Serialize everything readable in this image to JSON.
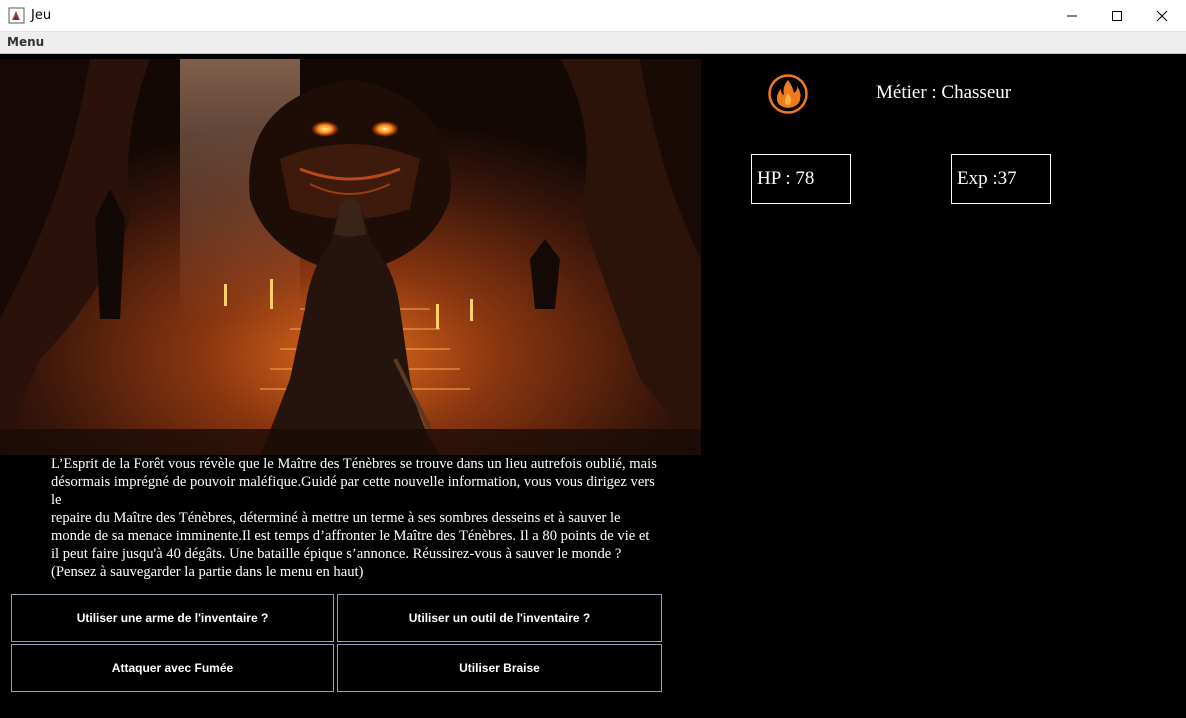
{
  "window": {
    "title": "Jeu",
    "controls": [
      "minimize-icon",
      "maximize-icon",
      "close-icon"
    ]
  },
  "menubar": {
    "menu_label": "Menu"
  },
  "scene": {
    "image_icon": "hooded-hero-facing-demon-in-cave"
  },
  "story": {
    "lines": [
      "L’Esprit de la Forêt vous révèle que le Maître des Ténèbres se trouve dans un lieu autrefois oublié, mais",
      "désormais imprégné de pouvoir maléfique.Guidé par cette nouvelle information, vous vous dirigez vers le",
      "repaire du Maître des Ténèbres, déterminé à mettre un terme à ses sombres desseins et à sauver le",
      "monde de sa menace imminente.Il est temps d’affronter le Maître des Ténèbres. Il a 80 points de vie et",
      "il peut faire jusqu'à 40 dégâts. Une bataille épique s’annonce. Réussirez-vous à sauver le monde ?",
      "(Pensez à sauvegarder la partie dans le menu en haut)"
    ]
  },
  "actions": {
    "weapon_label": "Utiliser une arme de l'inventaire ?",
    "tool_label": "Utiliser un outil de l'inventaire ?",
    "attack_label": "Attaquer avec Fumée",
    "braise_label": "Utiliser Braise"
  },
  "player": {
    "class_icon": "fire-icon",
    "class_text": "Métier : Chasseur",
    "hp_text": "HP :  78",
    "exp_text": "Exp :37"
  },
  "colors": {
    "background": "#000000",
    "button_border": "#8aa0bf",
    "fire_orange": "#f07a1e"
  }
}
